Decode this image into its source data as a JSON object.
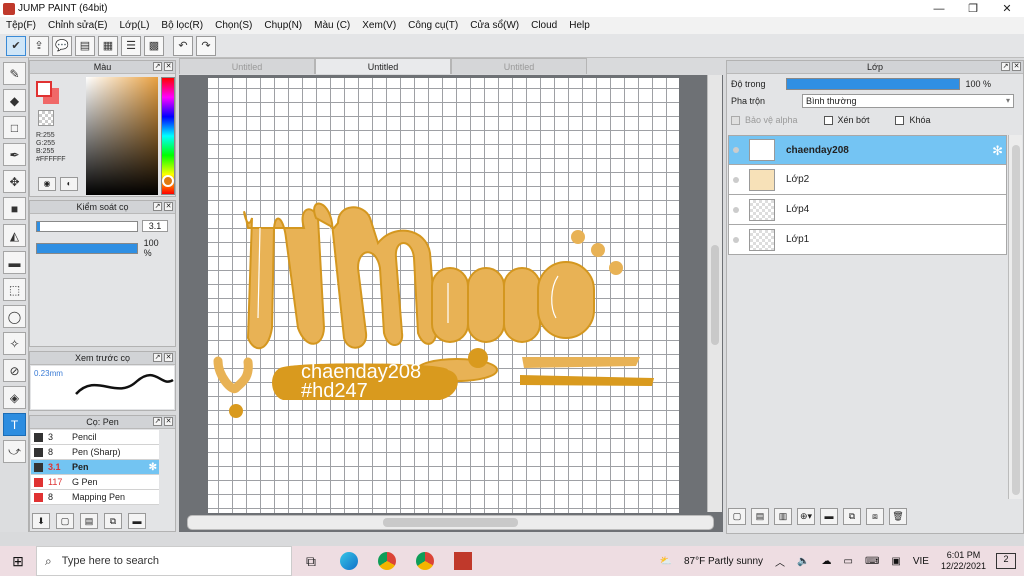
{
  "window": {
    "title": "JUMP PAINT (64bit)",
    "controls": [
      "—",
      "❐",
      "✕"
    ]
  },
  "menu": [
    "Tệp(F)",
    "Chỉnh sửa(E)",
    "Lớp(L)",
    "Bộ lọc(R)",
    "Chọn(S)",
    "Chụp(N)",
    "Màu (C)",
    "Xem(V)",
    "Công cụ(T)",
    "Cửa sổ(W)",
    "Cloud",
    "Help"
  ],
  "toolbar_icons": [
    "check-icon",
    "share-icon",
    "comment-icon",
    "message-icon",
    "document-icon",
    "list-icon",
    "grid-icon",
    "undo-icon",
    "redo-icon"
  ],
  "color_panel": {
    "title": "Màu",
    "r": "R:255",
    "g": "G:255",
    "b": "B:255",
    "hex": "#FFFFFF",
    "fg_color": "#e03232",
    "bg_color": "#f06868"
  },
  "brush_control": {
    "title": "Kiểm soát cọ",
    "size": "3.1",
    "opacity": "100 %",
    "size_fraction": 0.03,
    "opacity_fraction": 1.0
  },
  "preview": {
    "title": "Xem trước cọ",
    "size": "0.23mm"
  },
  "brush_list": {
    "title": "Cọ: Pen",
    "items": [
      {
        "size": "3",
        "name": "Pencil",
        "color": "#333333"
      },
      {
        "size": "8",
        "name": "Pen (Sharp)",
        "color": "#333333"
      },
      {
        "size": "3.1",
        "name": "Pen",
        "color": "#333333",
        "selected": true
      },
      {
        "size": "117",
        "name": "G Pen",
        "color": "#e03232"
      },
      {
        "size": "8",
        "name": "Mapping Pen",
        "color": "#e03232"
      }
    ]
  },
  "tabs": [
    "Untitled",
    "Untitled",
    "Untitled"
  ],
  "artwork": {
    "line1": "chaenday208",
    "line2": "#hd247",
    "accent": "#e8ad45",
    "dark_accent": "#d99a1e"
  },
  "layer_panel": {
    "title": "Lớp",
    "opacity_label": "Độ trong",
    "opacity_value": "100 %",
    "blend_label": "Pha trộn",
    "blend_value": "Bình thường",
    "protect_alpha": "Bảo vệ alpha",
    "clip": "Xén bớt",
    "lock": "Khóa",
    "layers": [
      {
        "name": "chaenday208",
        "selected": true
      },
      {
        "name": "Lớp2"
      },
      {
        "name": "Lớp4"
      },
      {
        "name": "Lớp1"
      }
    ]
  },
  "taskbar": {
    "search_placeholder": "Type here to search",
    "weather": "87°F  Partly sunny",
    "lang": "VIE",
    "time": "6:01 PM",
    "date": "12/22/2021",
    "notifications": "2"
  }
}
